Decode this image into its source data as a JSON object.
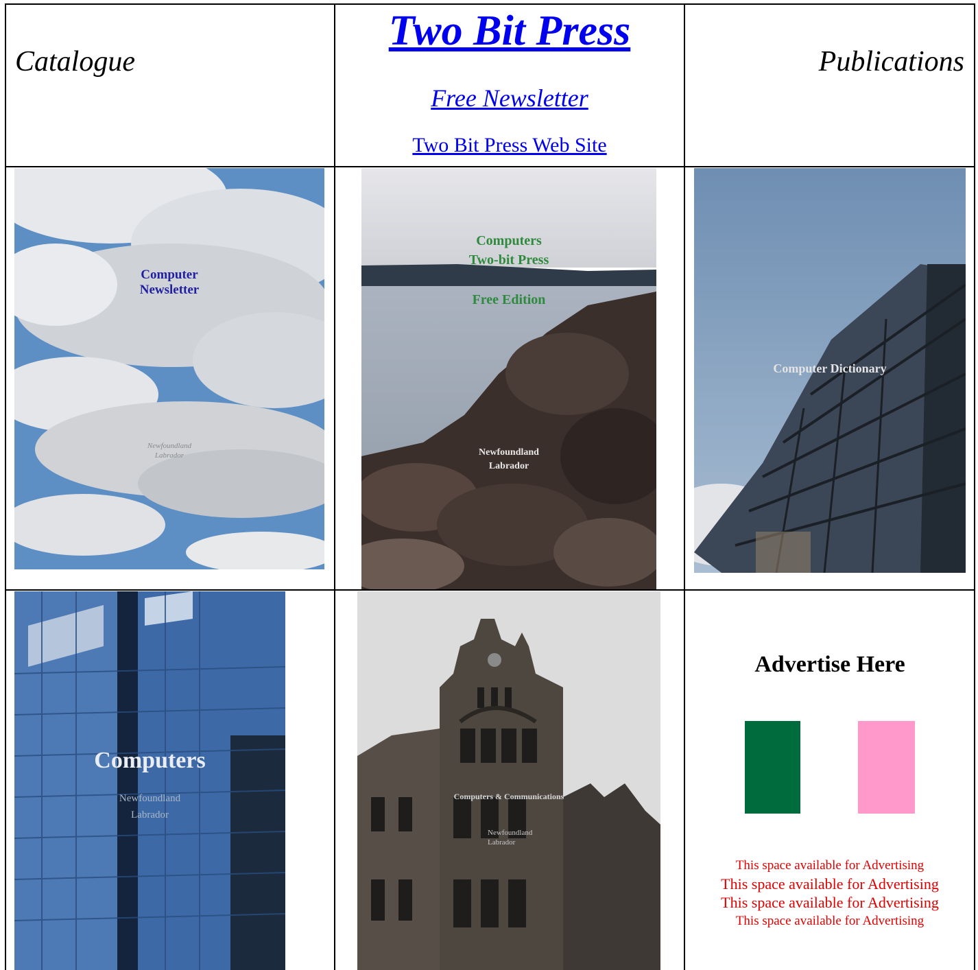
{
  "header": {
    "left_label": "Catalogue",
    "title_link": "Two Bit Press",
    "newsletter_link": "Free Newsletter",
    "website_link": "Two Bit Press Web Site",
    "right_label": "Publications"
  },
  "covers": {
    "newsletter": {
      "title_line1": "Computer",
      "title_line2": "Newsletter",
      "sub_line1": "Newfoundland",
      "sub_line2": "Labrador"
    },
    "free_edition": {
      "line1": "Computers",
      "line2": "Two-bit Press",
      "line3": "Free Edition",
      "sub_line1": "Newfoundland",
      "sub_line2": "Labrador"
    },
    "dictionary": {
      "title": "Computer Dictionary"
    },
    "computers": {
      "title": "Computers",
      "sub_line1": "Newfoundland",
      "sub_line2": "Labrador"
    },
    "communications": {
      "title": "Computers & Communications",
      "sub_line1": "Newfoundland",
      "sub_line2": "Labrador"
    }
  },
  "advert": {
    "heading": "Advertise Here",
    "swatch_colors": [
      "#006b3c",
      "#ff99cc"
    ],
    "lines": [
      "This space available for Advertising",
      "This space available for Advertising",
      "This space available for Advertising",
      "This space available for Advertising"
    ]
  }
}
